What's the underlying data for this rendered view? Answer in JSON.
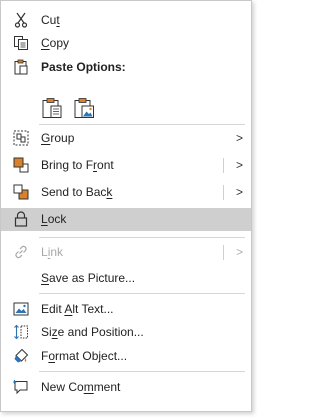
{
  "menu": {
    "items": [
      {
        "id": "cut",
        "pre": "Cu",
        "u": "t",
        "post": ""
      },
      {
        "id": "copy",
        "pre": "",
        "u": "C",
        "post": "opy"
      },
      {
        "id": "paste-options",
        "label": "Paste Options:"
      },
      {
        "id": "group",
        "pre": "",
        "u": "G",
        "post": "roup",
        "arrow": ">"
      },
      {
        "id": "bring-to-front",
        "pre": "Bring to F",
        "u": "r",
        "post": "ont",
        "arrow": ">"
      },
      {
        "id": "send-to-back",
        "pre": "Send to Bac",
        "u": "k",
        "post": "",
        "arrow": ">"
      },
      {
        "id": "lock",
        "pre": "",
        "u": "L",
        "post": "ock"
      },
      {
        "id": "link",
        "pre": "L",
        "u": "i",
        "post": "nk",
        "arrow": ">",
        "disabled": true
      },
      {
        "id": "save-as-picture",
        "pre": "",
        "u": "S",
        "post": "ave as Picture..."
      },
      {
        "id": "edit-alt-text",
        "pre": "Edit ",
        "u": "A",
        "post": "lt Text..."
      },
      {
        "id": "size-and-position",
        "pre": "Si",
        "u": "z",
        "post": "e and Position..."
      },
      {
        "id": "format-object",
        "pre": "F",
        "u": "o",
        "post": "rmat Object..."
      },
      {
        "id": "new-comment",
        "pre": "New Co",
        "u": "m",
        "post": "ment"
      }
    ]
  },
  "colors": {
    "highlight": "#cfcfcf",
    "accent_orange": "#d9822b",
    "accent_blue": "#2e74b5",
    "disabled": "#a8a8a8"
  },
  "icons": {
    "cut": "scissors-icon",
    "copy": "copy-icon",
    "paste": "clipboard-icon",
    "paste_keep": "paste-keep-formatting-icon",
    "paste_picture": "paste-picture-icon",
    "group": "group-icon",
    "bring_to_front": "bring-to-front-icon",
    "send_to_back": "send-to-back-icon",
    "lock": "lock-icon",
    "link": "link-icon",
    "edit_alt_text": "alt-text-icon",
    "size_position": "size-position-icon",
    "format_object": "format-object-icon",
    "new_comment": "new-comment-icon"
  }
}
